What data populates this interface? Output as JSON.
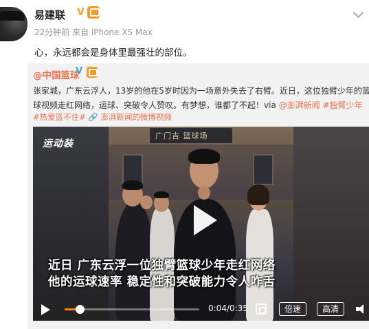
{
  "post": {
    "username": "易建联",
    "verified_glyph": "V",
    "meta": "22分钟前 来自 iPhone XS Max",
    "text": "心，永远都会是身体里最强壮的部位。"
  },
  "repost": {
    "username": "@中国篮球",
    "verified_glyph": "V",
    "body_line1": "张家城，广东云浮人，13岁的他在5岁时因为一场意外失去了右臂。近日，这位独臂少年的篮",
    "body_line2_prefix": "球视频走红网络，运球、突破令人赞叹。有梦想，谁都了不起！via ",
    "body_link1": "@澎湃新闻",
    "body_link2": " #独臂少年",
    "tags": "#热爱篮不住#   🔗 澎湃新闻的微博视频"
  },
  "video": {
    "logo": "运动装",
    "sign": "广门吉 篮球场",
    "caption_line1": "近日 广东云浮一位独臂篮球少年走红网络",
    "caption_line2": "他的运球速率 稳定性和突破能力令人咋舌",
    "progress": 0.114,
    "time": "0:04/0:35",
    "speed_label": "倍速",
    "quality_label": "高清",
    "accent_color": "#ff8200"
  }
}
